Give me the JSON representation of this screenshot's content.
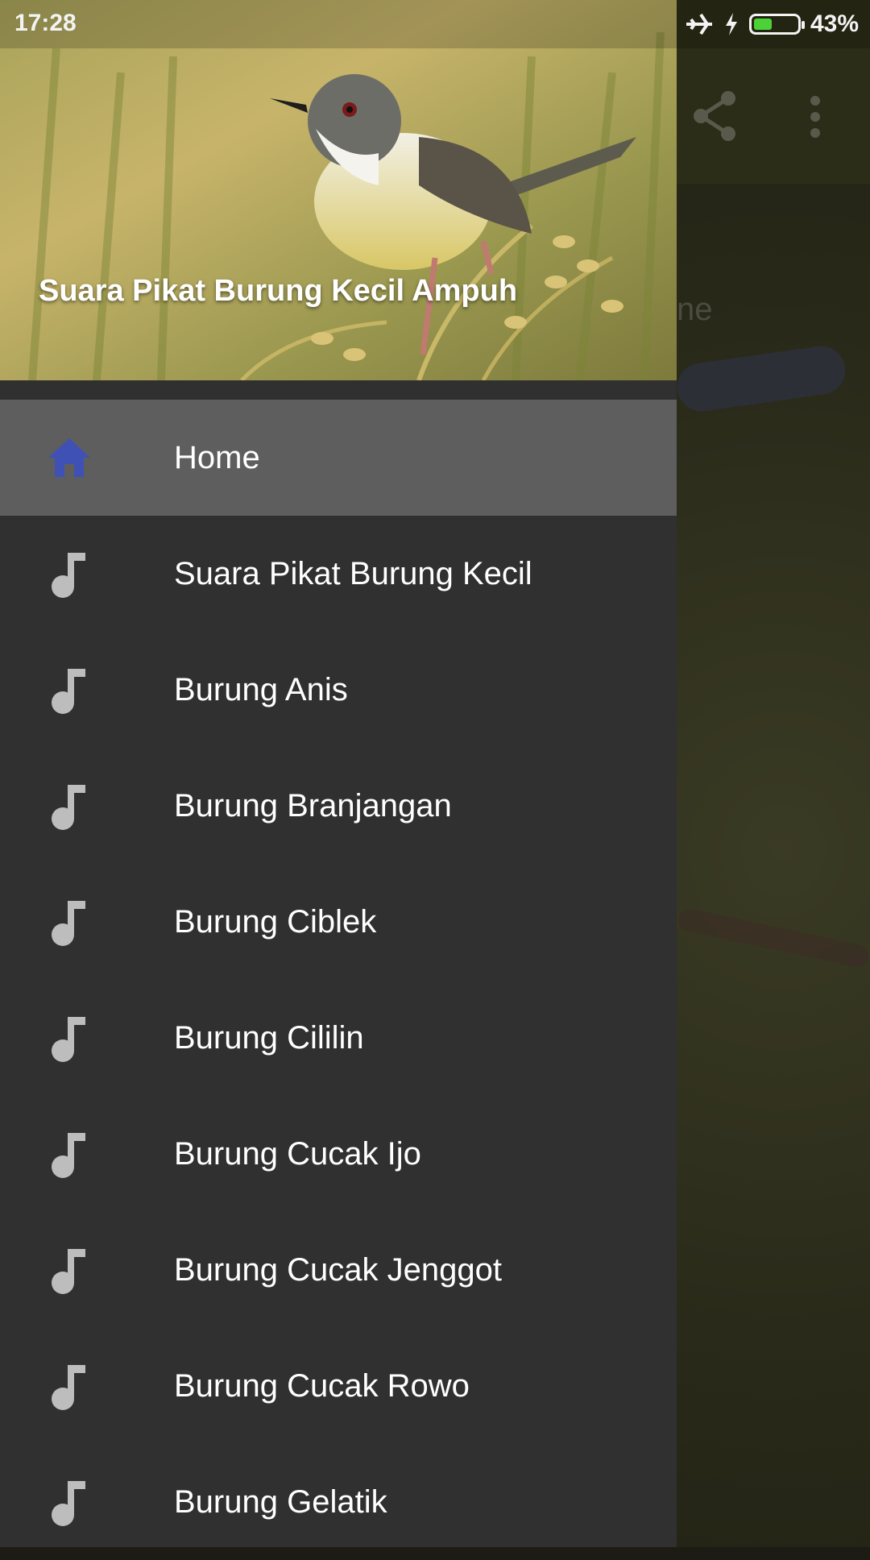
{
  "status_bar": {
    "time": "17:28",
    "battery_percent": "43%",
    "battery_level": 0.43,
    "icons": [
      "airplane-mode-icon",
      "charging-icon",
      "battery-icon"
    ]
  },
  "app_bar": {
    "actions": [
      "share-icon",
      "more-vert-icon"
    ]
  },
  "background_text": {
    "partial_label": "ne"
  },
  "drawer": {
    "header_title": "Suara Pikat Burung Kecil Ampuh",
    "items": [
      {
        "label": "Home",
        "icon": "home-icon",
        "selected": true
      },
      {
        "label": "Suara Pikat Burung Kecil",
        "icon": "music-note-icon"
      },
      {
        "label": "Burung Anis",
        "icon": "music-note-icon"
      },
      {
        "label": "Burung Branjangan",
        "icon": "music-note-icon"
      },
      {
        "label": "Burung Ciblek",
        "icon": "music-note-icon"
      },
      {
        "label": "Burung Cililin",
        "icon": "music-note-icon"
      },
      {
        "label": "Burung Cucak Ijo",
        "icon": "music-note-icon"
      },
      {
        "label": "Burung Cucak Jenggot",
        "icon": "music-note-icon"
      },
      {
        "label": "Burung Cucak Rowo",
        "icon": "music-note-icon"
      },
      {
        "label": "Burung Gelatik",
        "icon": "music-note-icon"
      }
    ]
  },
  "colors": {
    "home_icon": "#3f51b5",
    "note_icon": "#bdbdbd",
    "drawer_bg": "#303030",
    "selected_bg": "#5e5e5e",
    "battery_fill": "#4cd137"
  }
}
